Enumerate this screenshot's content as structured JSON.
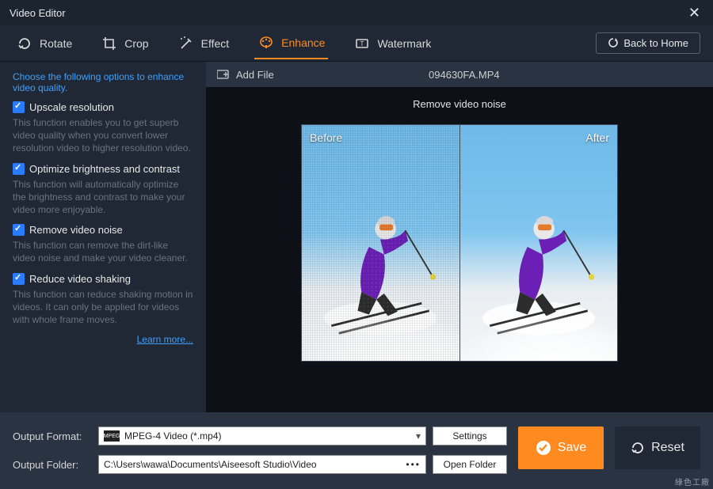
{
  "titlebar": {
    "title": "Video Editor"
  },
  "toolbar": {
    "tabs": [
      {
        "label": "Rotate"
      },
      {
        "label": "Crop"
      },
      {
        "label": "Effect"
      },
      {
        "label": "Enhance"
      },
      {
        "label": "Watermark"
      }
    ],
    "back_home": "Back to Home"
  },
  "sidebar": {
    "intro": "Choose the following options to enhance video quality.",
    "options": [
      {
        "label": "Upscale resolution",
        "desc": "This function enables you to get superb video quality when you convert lower resolution video to higher resolution video."
      },
      {
        "label": "Optimize brightness and contrast",
        "desc": "This function will automatically optimize the brightness and contrast to make your video more enjoyable."
      },
      {
        "label": "Remove video noise",
        "desc": "This function can remove the dirt-like video noise and make your video cleaner."
      },
      {
        "label": "Reduce video shaking",
        "desc": "This function can reduce shaking motion in videos. It can only be applied for videos with whole frame moves."
      }
    ],
    "learn_more": "Learn more..."
  },
  "main": {
    "add_file": "Add File",
    "filename": "094630FA.MP4",
    "preview_title": "Remove video noise",
    "before": "Before",
    "after": "After"
  },
  "bottom": {
    "format_label": "Output Format:",
    "format_value": "MPEG-4 Video (*.mp4)",
    "format_icon": "MPEG",
    "settings": "Settings",
    "folder_label": "Output Folder:",
    "folder_value": "C:\\Users\\wawa\\Documents\\Aiseesoft Studio\\Video",
    "open_folder": "Open Folder",
    "save": "Save",
    "reset": "Reset"
  },
  "footer_watermark": "綠色工廠"
}
